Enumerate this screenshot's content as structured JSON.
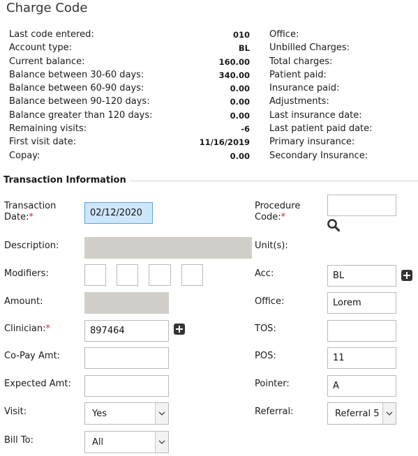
{
  "page": {
    "title": "Charge Code"
  },
  "summary": {
    "left": [
      {
        "label": "Last code entered:",
        "value": "010"
      },
      {
        "label": "Account type:",
        "value": "BL"
      },
      {
        "label": "Current balance:",
        "value": "160.00"
      },
      {
        "label": "Balance between 30-60 days:",
        "value": "340.00"
      },
      {
        "label": "Balance between 60-90 days:",
        "value": "0.00"
      },
      {
        "label": "Balance between 90-120 days:",
        "value": "0.00"
      },
      {
        "label": "Balance greater than 120 days:",
        "value": "0.00"
      },
      {
        "label": "Remaining visits:",
        "value": "-6"
      },
      {
        "label": "First visit date:",
        "value": "11/16/2019"
      },
      {
        "label": "Copay:",
        "value": "0.00"
      }
    ],
    "right": [
      "Office:",
      "Unbilled Charges:",
      "Total charges:",
      "Patient paid:",
      "Insurance paid:",
      "Adjustments:",
      "Last insurance date:",
      "Last patient paid date:",
      "Primary insurance:",
      "Secondary Insurance:"
    ]
  },
  "section_title": "Transaction Information",
  "form": {
    "transaction_date_label": "Transaction Date:",
    "transaction_date_value": "02/12/2020",
    "procedure_code_label": "Procedure Code:",
    "procedure_code_value": "",
    "description_label": "Description:",
    "units_label": "Unit(s):",
    "modifiers_label": "Modifiers:",
    "acc_label": "Acc:",
    "acc_value": "BL",
    "amount_label": "Amount:",
    "office_label": "Office:",
    "office_value": "Lorem",
    "clinician_label": "Clinician:",
    "clinician_value": "897464",
    "tos_label": "TOS:",
    "tos_value": "",
    "copay_amt_label": "Co-Pay Amt:",
    "copay_amt_value": "",
    "pos_label": "POS:",
    "pos_value": "11",
    "expected_amt_label": "Expected Amt:",
    "expected_amt_value": "",
    "pointer_label": "Pointer:",
    "pointer_value": "A",
    "visit_label": "Visit:",
    "visit_value": "Yes",
    "referral_label": "Referral:",
    "referral_value": "Referral 5",
    "bill_to_label": "Bill To:",
    "bill_to_value": "All",
    "required_mark": "*"
  }
}
